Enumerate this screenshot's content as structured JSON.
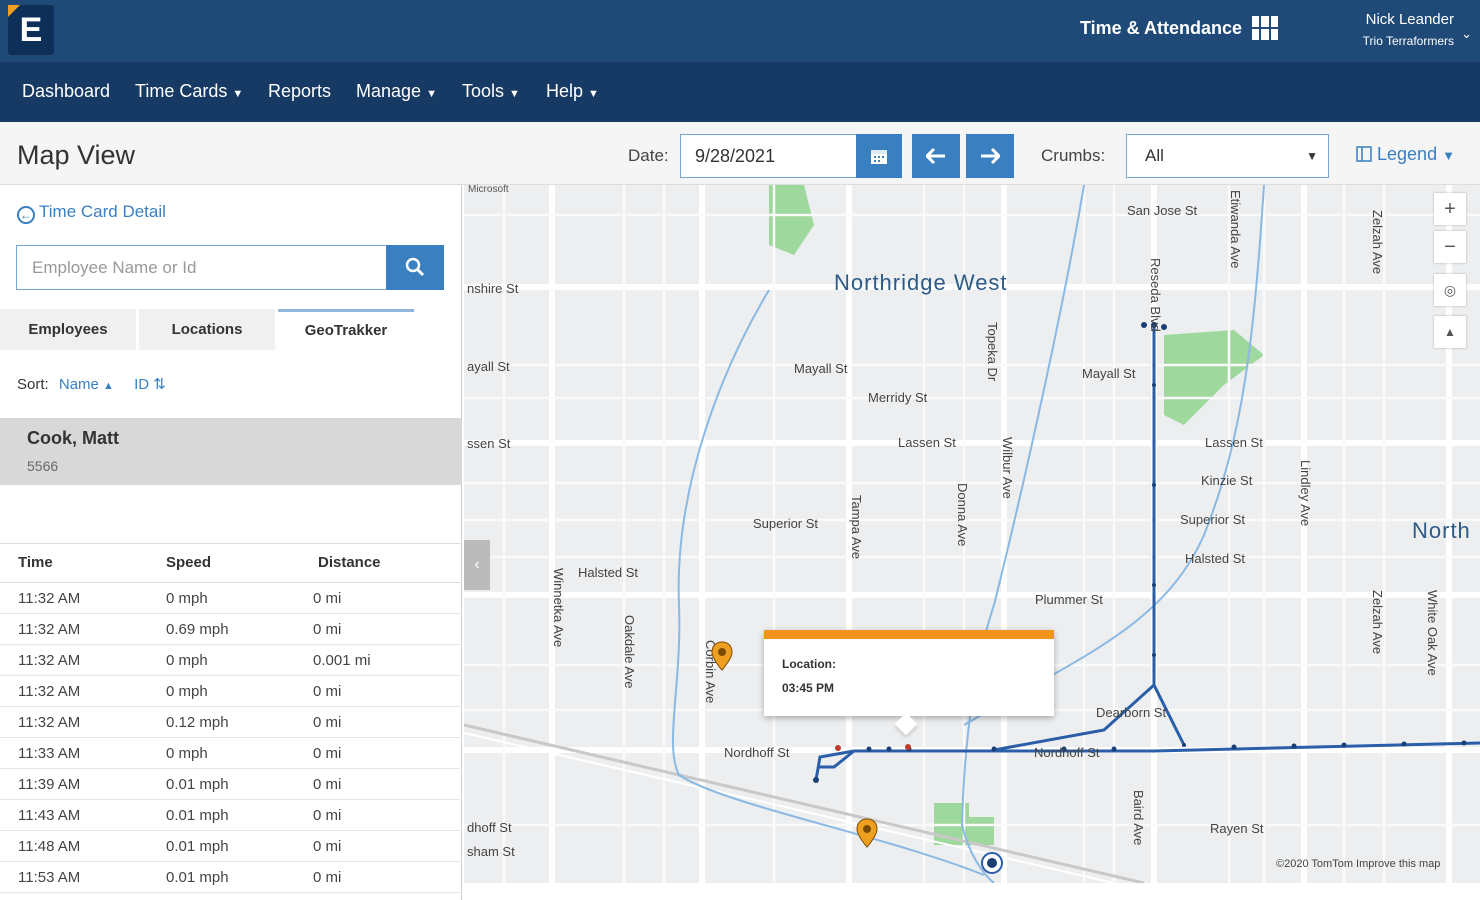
{
  "header": {
    "logo_letter": "E",
    "app_title": "Time & Attendance",
    "user_name": "Nick Leander",
    "company": "Trio Terraformers"
  },
  "nav": {
    "dashboard": "Dashboard",
    "time_cards": "Time Cards",
    "reports": "Reports",
    "manage": "Manage",
    "tools": "Tools",
    "help": "Help"
  },
  "toolbar": {
    "page_title": "Map View",
    "date_label": "Date:",
    "date_value": "9/28/2021",
    "crumbs_label": "Crumbs:",
    "crumbs_value": "All",
    "legend_label": "Legend"
  },
  "left_panel": {
    "time_card_link": "Time Card Detail",
    "search_placeholder": "Employee Name or Id",
    "tabs": [
      "Employees",
      "Locations",
      "GeoTrakker"
    ],
    "sort_label": "Sort:",
    "sort_name": "Name",
    "sort_id": "ID",
    "employee": {
      "name": "Cook, Matt",
      "id": "5566"
    },
    "table": {
      "headers": [
        "Time",
        "Speed",
        "Distance"
      ],
      "rows": [
        [
          "11:32 AM",
          "0 mph",
          "0 mi"
        ],
        [
          "11:32 AM",
          "0.69 mph",
          "0 mi"
        ],
        [
          "11:32 AM",
          "0 mph",
          "0.001 mi"
        ],
        [
          "11:32 AM",
          "0 mph",
          "0 mi"
        ],
        [
          "11:32 AM",
          "0.12 mph",
          "0 mi"
        ],
        [
          "11:33 AM",
          "0 mph",
          "0 mi"
        ],
        [
          "11:39 AM",
          "0.01 mph",
          "0 mi"
        ],
        [
          "11:43 AM",
          "0.01 mph",
          "0 mi"
        ],
        [
          "11:48 AM",
          "0.01 mph",
          "0 mi"
        ],
        [
          "11:53 AM",
          "0.01 mph",
          "0 mi"
        ]
      ]
    }
  },
  "map": {
    "provider": "Microsoft",
    "area_label": "Northridge West",
    "area_label_2": "North",
    "popup": {
      "line1": "Location:",
      "line2": "03:45 PM"
    },
    "copyright": "©2020 TomTom Improve this map",
    "streets": {
      "san_jose": "San Jose St",
      "wilshire": "nshire St",
      "mayall_left": "ayall St",
      "mayall_mid": "Mayall St",
      "mayall_right": "Mayall St",
      "merridy": "Merridy St",
      "lassen_left": "ssen St",
      "lassen_mid": "Lassen St",
      "lassen_right": "Lassen St",
      "kinzie": "Kinzie St",
      "superior_mid": "Superior St",
      "superior_right": "Superior St",
      "halsted_left": "Halsted St",
      "halsted_right": "Halsted St",
      "plummer": "Plummer St",
      "dearborn": "Dearborn St",
      "nordhoff_mid": "Nordhoff St",
      "nordhoff_right": "Nordhoff St",
      "nordhoff_left": "dhoff St",
      "sham": "sham St",
      "rayen": "Rayen St",
      "winnetka": "Winnetka Ave",
      "oakdale": "Oakdale Ave",
      "corbin": "Corbin Ave",
      "tampa": "Tampa Ave",
      "topeka": "Topeka Dr",
      "wilbur": "Wilbur Ave",
      "donna": "Donna Ave",
      "reseda": "Reseda Blvd",
      "etiwanda": "Etiwanda Ave",
      "lindley": "Lindley Ave",
      "zelzah": "Zelzah Ave",
      "zelzah2": "Zelzah Ave",
      "white_oak": "White Oak Ave",
      "baird": "Baird Ave"
    }
  },
  "colors": {
    "header_bg": "#1f4a78",
    "nav_bg": "#163a63",
    "accent": "#3a7fc0",
    "popup_bar": "#f0941e",
    "route": "#2a5ea8"
  }
}
